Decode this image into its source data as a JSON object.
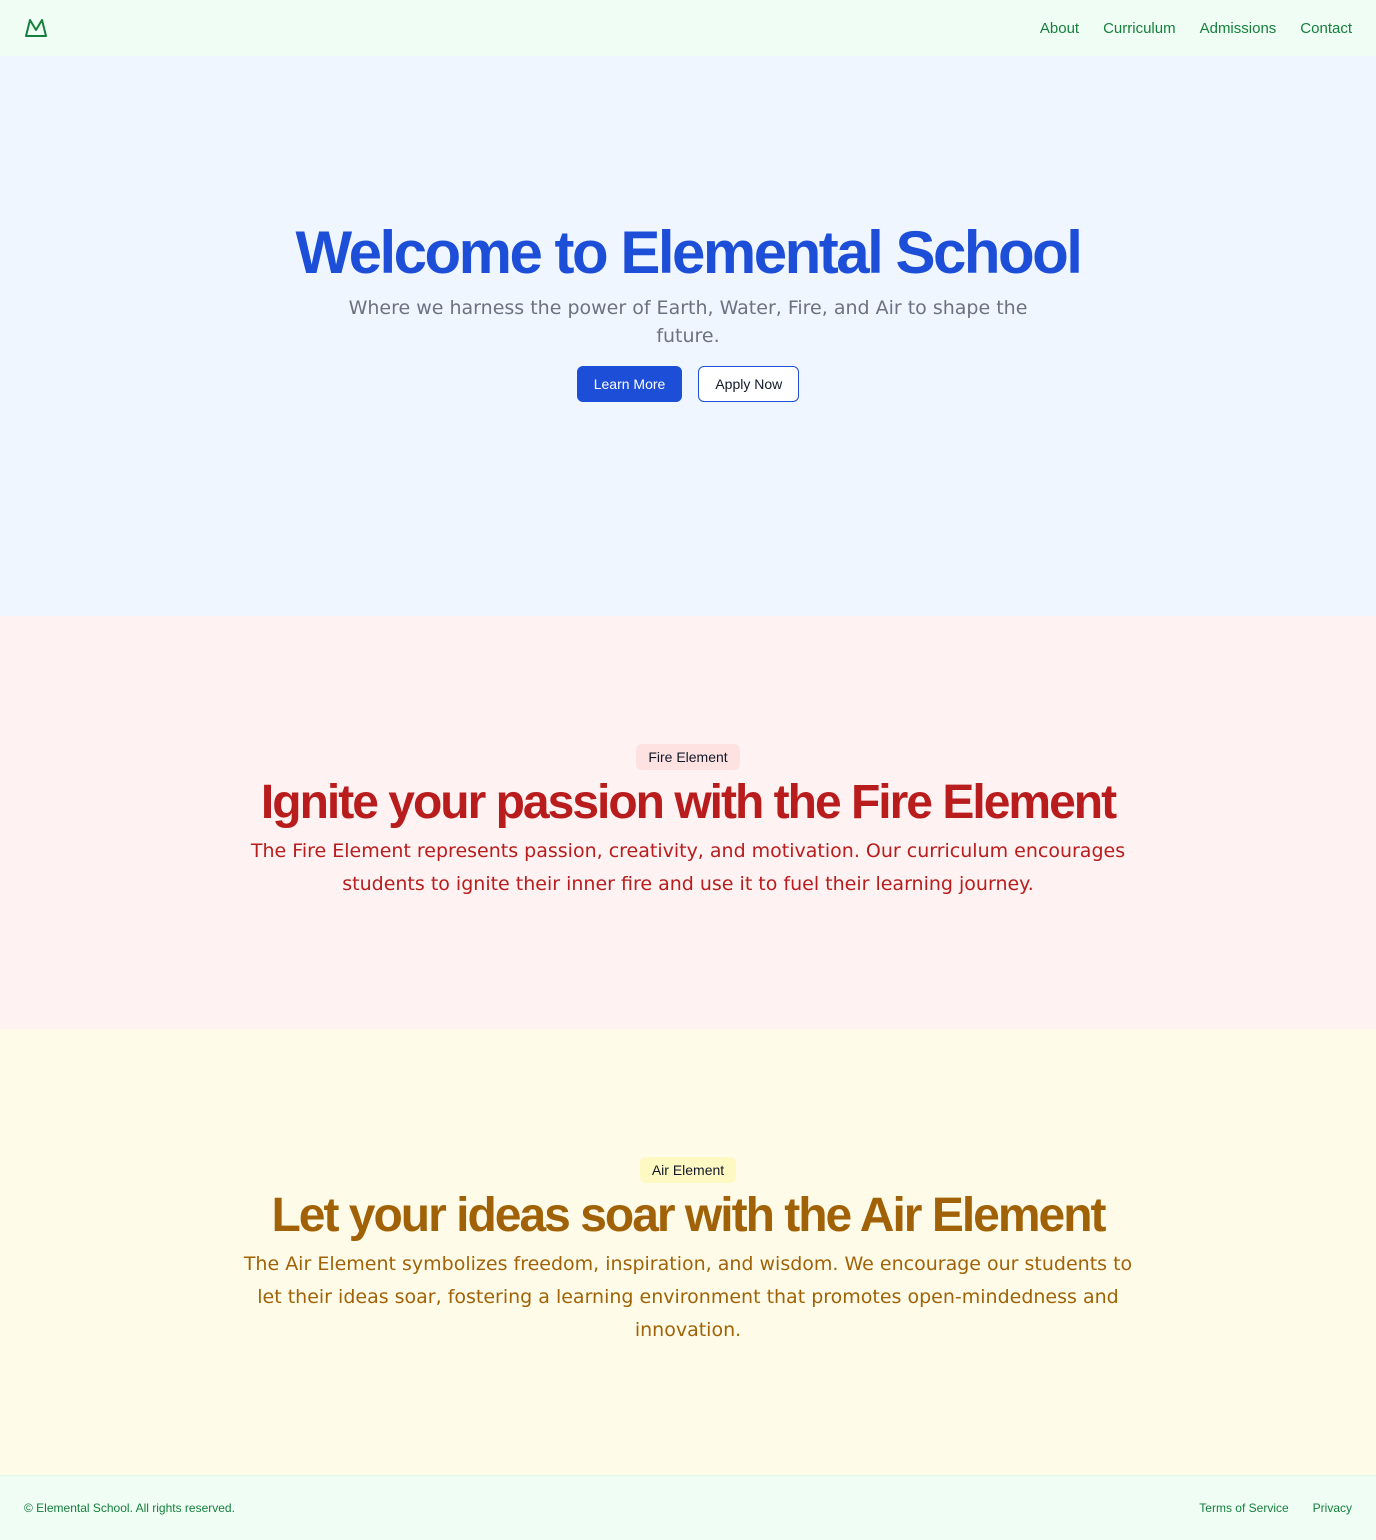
{
  "header": {
    "logo_icon": "mountain-icon",
    "nav": [
      "About",
      "Curriculum",
      "Admissions",
      "Contact"
    ]
  },
  "hero": {
    "title": "Welcome to Elemental School",
    "subtitle": "Where we harness the power of Earth, Water, Fire, and Air to shape the future.",
    "primary_button": "Learn More",
    "secondary_button": "Apply Now"
  },
  "fire": {
    "badge": "Fire Element",
    "title": "Ignite your passion with the Fire Element",
    "body": "The Fire Element represents passion, creativity, and motivation. Our curriculum encourages students to ignite their inner fire and use it to fuel their learning journey."
  },
  "air": {
    "badge": "Air Element",
    "title": "Let your ideas soar with the Air Element",
    "body": "The Air Element symbolizes freedom, inspiration, and wisdom. We encourage our students to let their ideas soar, fostering a learning environment that promotes open-mindedness and innovation."
  },
  "footer": {
    "copyright": "© Elemental School. All rights reserved.",
    "links": [
      "Terms of Service",
      "Privacy"
    ]
  },
  "colors": {
    "brand_green": "#15803d",
    "hero_blue": "#1d4ed8",
    "fire_red": "#b91c1c",
    "air_amber": "#a16207"
  }
}
